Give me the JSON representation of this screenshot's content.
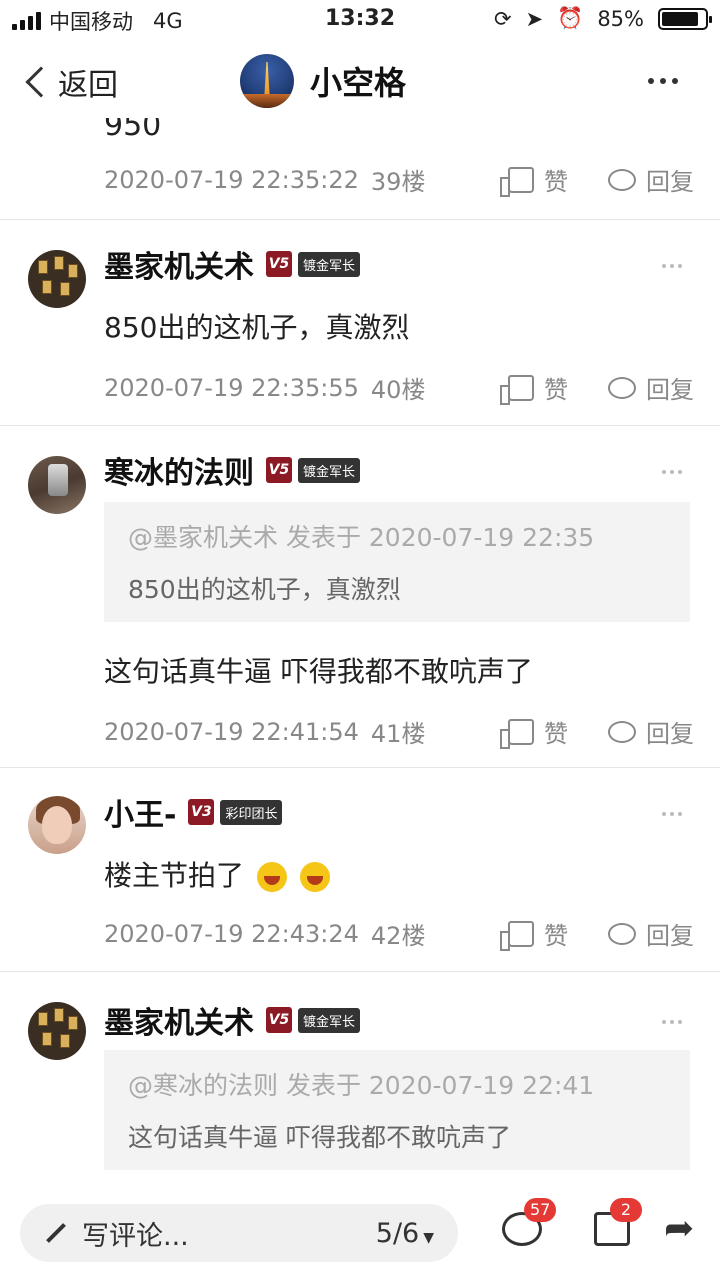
{
  "status_bar": {
    "carrier": "中国移动",
    "network": "4G",
    "time": "13:32",
    "battery": "85%",
    "battery_level": 0.85
  },
  "nav": {
    "back_label": "返回",
    "title": "小空格"
  },
  "feed": {
    "cut_text": "950",
    "first_meta": {
      "time": "2020-07-19 22:35:22",
      "floor": "39楼",
      "like": "赞",
      "reply": "回复"
    },
    "comments": [
      {
        "name": "墨家机关术",
        "level": "V5",
        "rank": "镀金军长",
        "text": "850出的这机子，真激烈",
        "time": "2020-07-19 22:35:55",
        "floor": "40楼",
        "like": "赞",
        "reply": "回复"
      },
      {
        "name": "寒冰的法则",
        "level": "V5",
        "rank": "镀金军长",
        "quote": {
          "head": "@墨家机关术 发表于 2020-07-19 22:35",
          "body": "850出的这机子，真激烈"
        },
        "text": "这句话真牛逼 吓得我都不敢吭声了",
        "time": "2020-07-19 22:41:54",
        "floor": "41楼",
        "like": "赞",
        "reply": "回复"
      },
      {
        "name": "小王-",
        "level": "V3",
        "rank": "彩印团长",
        "text": "楼主节拍了",
        "time": "2020-07-19 22:43:24",
        "floor": "42楼",
        "like": "赞",
        "reply": "回复"
      },
      {
        "name": "墨家机关术",
        "level": "V5",
        "rank": "镀金军长",
        "quote": {
          "head": "@寒冰的法则 发表于 2020-07-19 22:41",
          "body": "这句话真牛逼 吓得我都不敢吭声了"
        }
      }
    ]
  },
  "bottom_bar": {
    "placeholder": "写评论...",
    "page": "5/6",
    "comment_count": "57",
    "like_count": "2"
  }
}
